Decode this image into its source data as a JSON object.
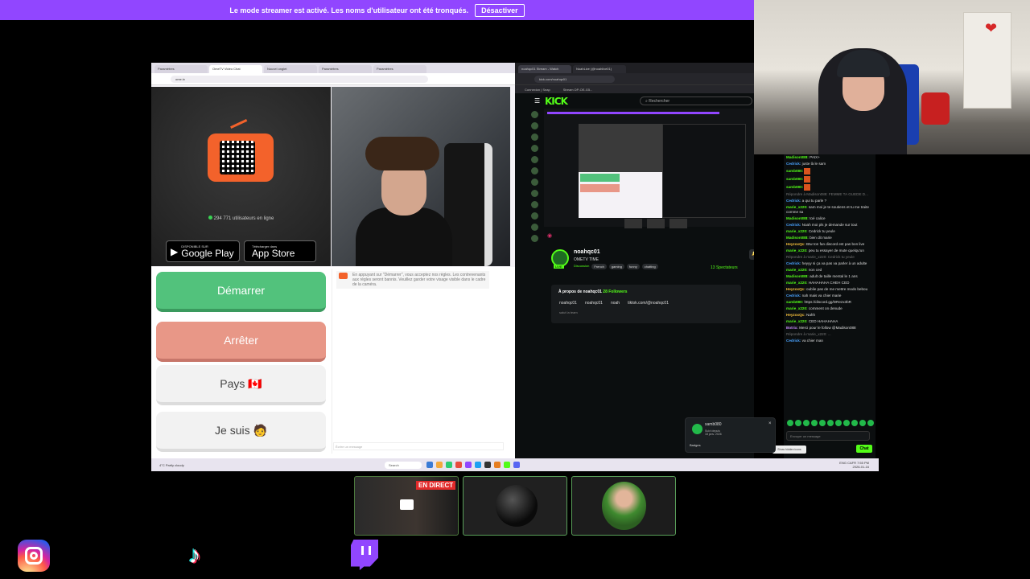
{
  "banner": {
    "text": "Le mode streamer est activé. Les noms d'utilisateur ont été tronqués.",
    "button": "Désactiver",
    "color": "#9146ff"
  },
  "left_browser": {
    "tabs": [
      "Paramètres",
      "OmeTV Video Chat",
      "Nouvel onglet",
      "Paramètres",
      "Paramètres"
    ],
    "url": "ome.tv",
    "ometv": {
      "users_online": "294 771 utilisateurs en ligne",
      "google_play_l1": "DISPONIBLE SUR",
      "google_play_l2": "Google Play",
      "app_store_l1": "Télécharger dans",
      "app_store_l2": "App Store",
      "btn_start": "Démarrer",
      "btn_stop": "Arrêter",
      "btn_country": "Pays 🇨🇦",
      "btn_iam": "Je suis 🧑",
      "notice": "En appuyant sur \"Démarrer\", vous acceptez nos règles. Les contrevenants aux règles seront bannis. Veuillez garder votre visage visible dans le cadre de la caméra.",
      "chat_placeholder": "Écrire un message"
    }
  },
  "taskbar": {
    "weather": "4°C Partly cloudy",
    "search": "Search",
    "time": "7:55 PM",
    "date": "2026-01-16",
    "lang": "ENG CAFR"
  },
  "right_browser": {
    "tabs": [
      "noahqc01 Stream - Watch",
      "NoahLive (@noahlive01)"
    ],
    "url": "kick.com/noahqc01",
    "bookmarks": [
      "Connexion | Snap",
      "Stream DP-OE-G5..."
    ],
    "kick": {
      "logo": "KICK",
      "search_placeholder": "Rechercher",
      "streamer": "noahqc01",
      "live_badge": "LIVE",
      "stream_title": "OMETV TIME",
      "category": "Discussion",
      "tags": [
        "French",
        "gaming",
        "funny",
        "chatting"
      ],
      "viewers": "13 Spectateurs",
      "about_title": "À propos de noahqc01",
      "followers": "28 Followers",
      "socials": [
        "noahqc01",
        "noahqc01",
        "noah",
        "tiktok.com/@noahqc01"
      ],
      "bio": "salut la team"
    }
  },
  "chat": {
    "messages": [
      {
        "user": "Madison088",
        "color": "g",
        "text": "PAIX+"
      },
      {
        "user": "Cedrick",
        "color": "b",
        "text": "juste là le sam"
      },
      {
        "user": "samb080",
        "color": "g",
        "text": ""
      },
      {
        "user": "samb080",
        "color": "g",
        "text": ""
      },
      {
        "user": "samb080",
        "color": "g",
        "text": ""
      },
      {
        "user": "",
        "color": "",
        "text": "Répondre à Madison088: FEMME TA GUEDE D..."
      },
      {
        "user": "Cedrick",
        "color": "b",
        "text": "a qui tu parle ?"
      },
      {
        "user": "marie_x220",
        "color": "g",
        "text": "sam moi je te soutiens et tu me traite comme sa"
      },
      {
        "user": "Madison088",
        "color": "g",
        "text": "toé calice"
      },
      {
        "user": "Cedrick",
        "color": "b",
        "text": "Noah moi pls je demande sur tout"
      },
      {
        "user": "marie_x220",
        "color": "g",
        "text": "Cedrick tu yeule"
      },
      {
        "user": "Madison088",
        "color": "g",
        "text": "bien dit marie"
      },
      {
        "user": "HeyzoxQc",
        "color": "y",
        "text": "Btw ton fan discord est pas bon live"
      },
      {
        "user": "marie_x220",
        "color": "g",
        "text": "peu tu essayer de mute quelqu'un"
      },
      {
        "user": "",
        "color": "",
        "text": "Répondre à marie_x220: Cedrick tu yeule"
      },
      {
        "user": "Cedrick",
        "color": "b",
        "text": "heyyy si ça va pas va parler à un adulte"
      },
      {
        "user": "marie_x220",
        "color": "g",
        "text": "non ced"
      },
      {
        "user": "Madison088",
        "color": "g",
        "text": "adult de taille mental le 1 ans"
      },
      {
        "user": "marie_x220",
        "color": "g",
        "text": "HAHAHAHA CHEH CED"
      },
      {
        "user": "HeyzoxQc",
        "color": "y",
        "text": "oublie pas de me mettre modo bebou"
      },
      {
        "user": "Cedrick",
        "color": "b",
        "text": "nah mais va chier marie"
      },
      {
        "user": "samb080",
        "color": "g",
        "text": "https://discord.gg/DRezx3bR"
      },
      {
        "user": "marie_x220",
        "color": "g",
        "text": "comment on denude"
      },
      {
        "user": "HeyzoxQc",
        "color": "y",
        "text": "Nahh"
      },
      {
        "user": "marie_x220",
        "color": "g",
        "text": "CED HAHAHAHA"
      },
      {
        "user": "Botrix",
        "color": "p",
        "text": "Merci pour le follow @Madison088"
      },
      {
        "user": "",
        "color": "",
        "text": "Répondre à marie_x220: ..."
      },
      {
        "user": "Cedrick",
        "color": "b",
        "text": "va chier man"
      }
    ],
    "input_placeholder": "Envoyer un message",
    "send_label": "Chat",
    "hidden_icons_tooltip": "Show hidden icons",
    "popup": {
      "name": "samb080",
      "since_label": "Suivi depuis",
      "since": "18 janv. 2026",
      "badges_label": "Badges"
    }
  },
  "overlay": {
    "live_label": "EN DIRECT",
    "socials": [
      "instagram-icon",
      "tiktok-icon",
      "twitch-icon"
    ]
  }
}
